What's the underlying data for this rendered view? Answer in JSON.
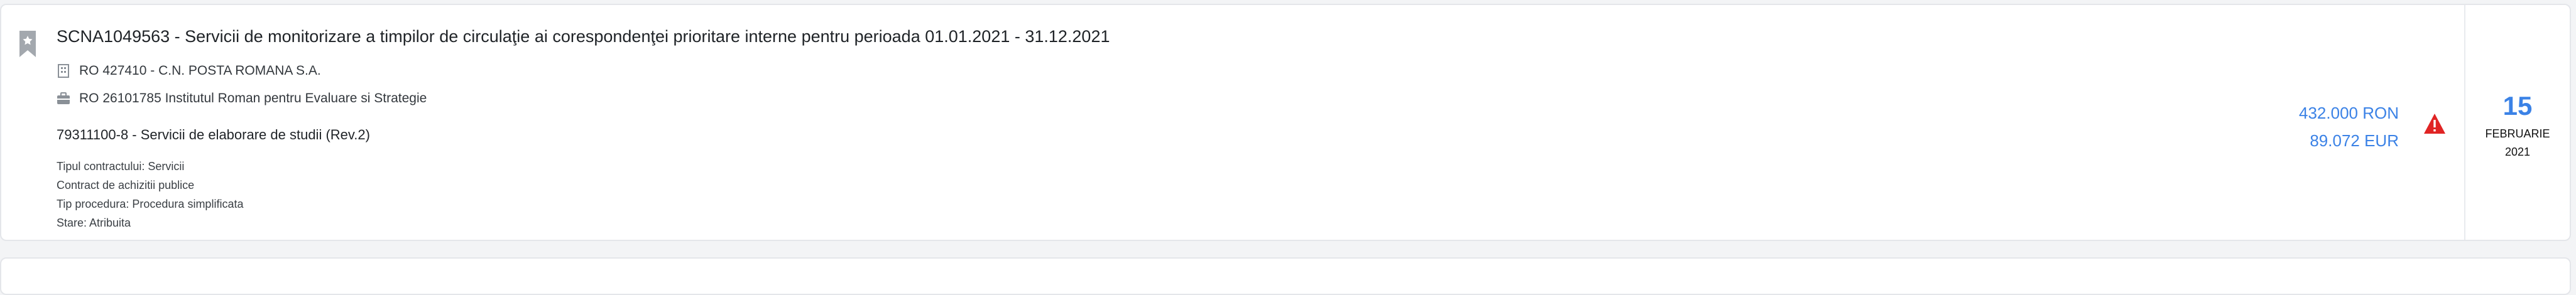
{
  "listing": {
    "title": "SCNA1049563 - Servicii de monitorizare a timpilor de circulaţie ai corespondenţei prioritare interne pentru perioada 01.01.2021 - 31.12.2021",
    "authority": "RO 427410 - C.N. POSTA ROMANA S.A.",
    "supplier": "RO 26101785 Institutul Roman pentru Evaluare si Strategie",
    "cpv": "79311100-8 - Servicii de elaborare de studii (Rev.2)",
    "details": [
      "Tipul contractului: Servicii",
      "Contract de achizitii publice",
      "Tip procedura: Procedura simplificata",
      "Stare: Atribuita"
    ],
    "value_ron": "432.000 RON",
    "value_eur": "89.072 EUR",
    "date": {
      "day": "15",
      "month": "FEBRUARIE",
      "year": "2021"
    },
    "icons": {
      "bookmark": "bookmark-icon",
      "authority": "building-icon",
      "supplier": "briefcase-icon",
      "warning": "warning-icon"
    },
    "colors": {
      "accent": "#3b82e6",
      "warning": "#e02424",
      "bookmark": "#9aa0a6"
    }
  }
}
